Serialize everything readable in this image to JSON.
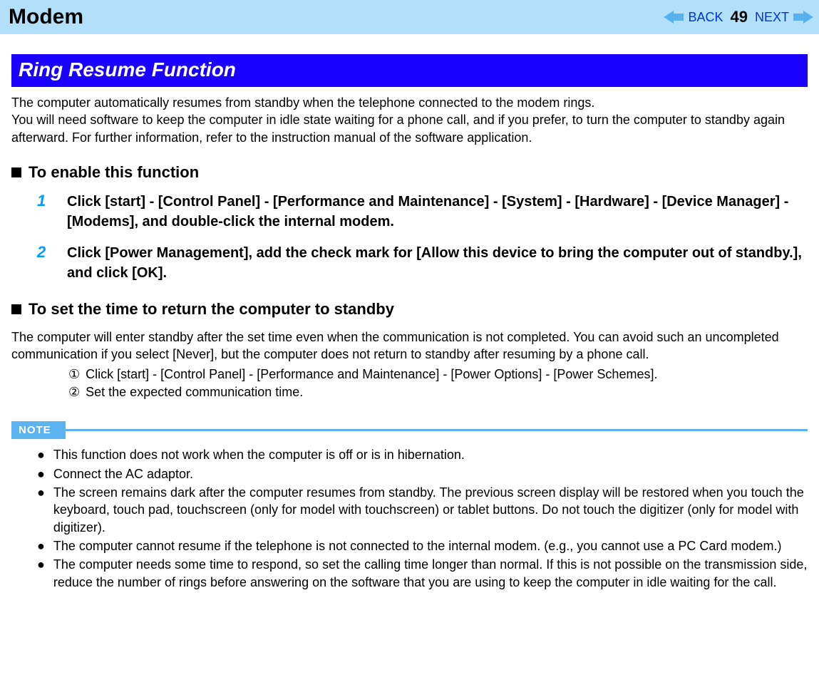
{
  "header": {
    "title": "Modem",
    "back_label": "BACK",
    "next_label": "NEXT",
    "page_number": "49"
  },
  "section_title": "Ring Resume Function",
  "intro_para": "The computer automatically resumes from standby when the telephone connected to the modem rings.\nYou will need software to keep the computer in idle state waiting for a phone call, and if you prefer, to turn the computer to standby again afterward. For further information, refer to the instruction manual of the software application.",
  "enable_heading": "To enable this function",
  "steps": [
    {
      "num": "1",
      "text": "Click [start] - [Control Panel] - [Performance and Maintenance] - [System] - [Hardware] - [Device Manager] - [Modems], and double-click the internal modem."
    },
    {
      "num": "2",
      "text": "Click [Power Management], add the check mark for [Allow this device to bring the computer out of standby.], and click [OK]."
    }
  ],
  "settime_heading": "To set the time to return the computer to standby",
  "settime_para": "The computer will enter standby after the set time even when the communication is not completed. You can avoid such an uncompleted communication if you select [Never], but the computer does not return to standby after resuming by a phone call.",
  "circled_items": [
    {
      "marker": "①",
      "text": "Click [start] - [Control Panel] - [Performance and Maintenance] - [Power Options] - [Power Schemes]."
    },
    {
      "marker": "②",
      "text": "Set the expected communication time."
    }
  ],
  "note_label": "NOTE",
  "note_bullets": [
    "This function does not work when the computer is off or is in hibernation.",
    "Connect the AC adaptor.",
    "The screen remains dark after the computer resumes from standby. The previous screen display will be restored when you touch the keyboard, touch pad, touchscreen (only for model with touchscreen) or tablet buttons. Do not touch the digitizer (only for model with digitizer).",
    "The computer cannot resume if the telephone is not connected to the internal modem. (e.g., you cannot use a PC Card modem.)",
    "The computer needs some time to respond, so set the calling time longer than normal. If this is not possible on the transmission side, reduce the number of rings before answering on the software that you are using to keep the computer in idle waiting for the call."
  ]
}
